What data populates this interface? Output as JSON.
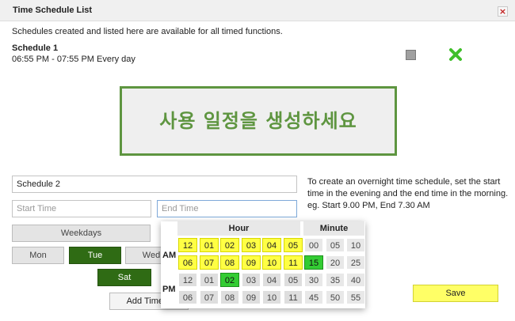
{
  "header": {
    "title": "Time Schedule List",
    "close_label": "×"
  },
  "description": "Schedules created and listed here are available for all timed functions.",
  "schedules": [
    {
      "name": "Schedule 1",
      "time": "06:55 PM - 07:55 PM Every day"
    }
  ],
  "callout": "사용 일정을 생성하세요",
  "form": {
    "name_value": "Schedule 2",
    "start_placeholder": "Start Time",
    "end_placeholder": "End Time",
    "hint": "To create an overnight time schedule, set the start time in the evening and the end time in the morning. eg. Start 9.00 PM, End 7.30 AM",
    "weekdays_label": "Weekdays",
    "days": [
      {
        "label": "Mon",
        "selected": false
      },
      {
        "label": "Tue",
        "selected": true
      },
      {
        "label": "Wed",
        "selected": false
      },
      {
        "label": "Sat",
        "selected": true
      }
    ],
    "add_label": "Add Time S",
    "save_label": "Save"
  },
  "picker": {
    "hour_label": "Hour",
    "minute_label": "Minute",
    "am_label": "AM",
    "pm_label": "PM",
    "am_hours": [
      [
        "12",
        "01",
        "02",
        "03",
        "04",
        "05"
      ],
      [
        "06",
        "07",
        "08",
        "09",
        "10",
        "11"
      ]
    ],
    "pm_hours": [
      [
        "12",
        "01",
        "02",
        "03",
        "04",
        "05"
      ],
      [
        "06",
        "07",
        "08",
        "09",
        "10",
        "11"
      ]
    ],
    "minutes": [
      [
        "00",
        "05",
        "10"
      ],
      [
        "15",
        "20",
        "25"
      ],
      [
        "30",
        "35",
        "40"
      ],
      [
        "45",
        "50",
        "55"
      ]
    ],
    "selected_hour": "PM 02",
    "selected_minute": "15"
  },
  "colors": {
    "accent_green": "#5e9540",
    "selected_day": "#2f6b14",
    "am_highlight": "#ffff44",
    "selected_cell": "#33cc33",
    "save": "#ffff66"
  }
}
